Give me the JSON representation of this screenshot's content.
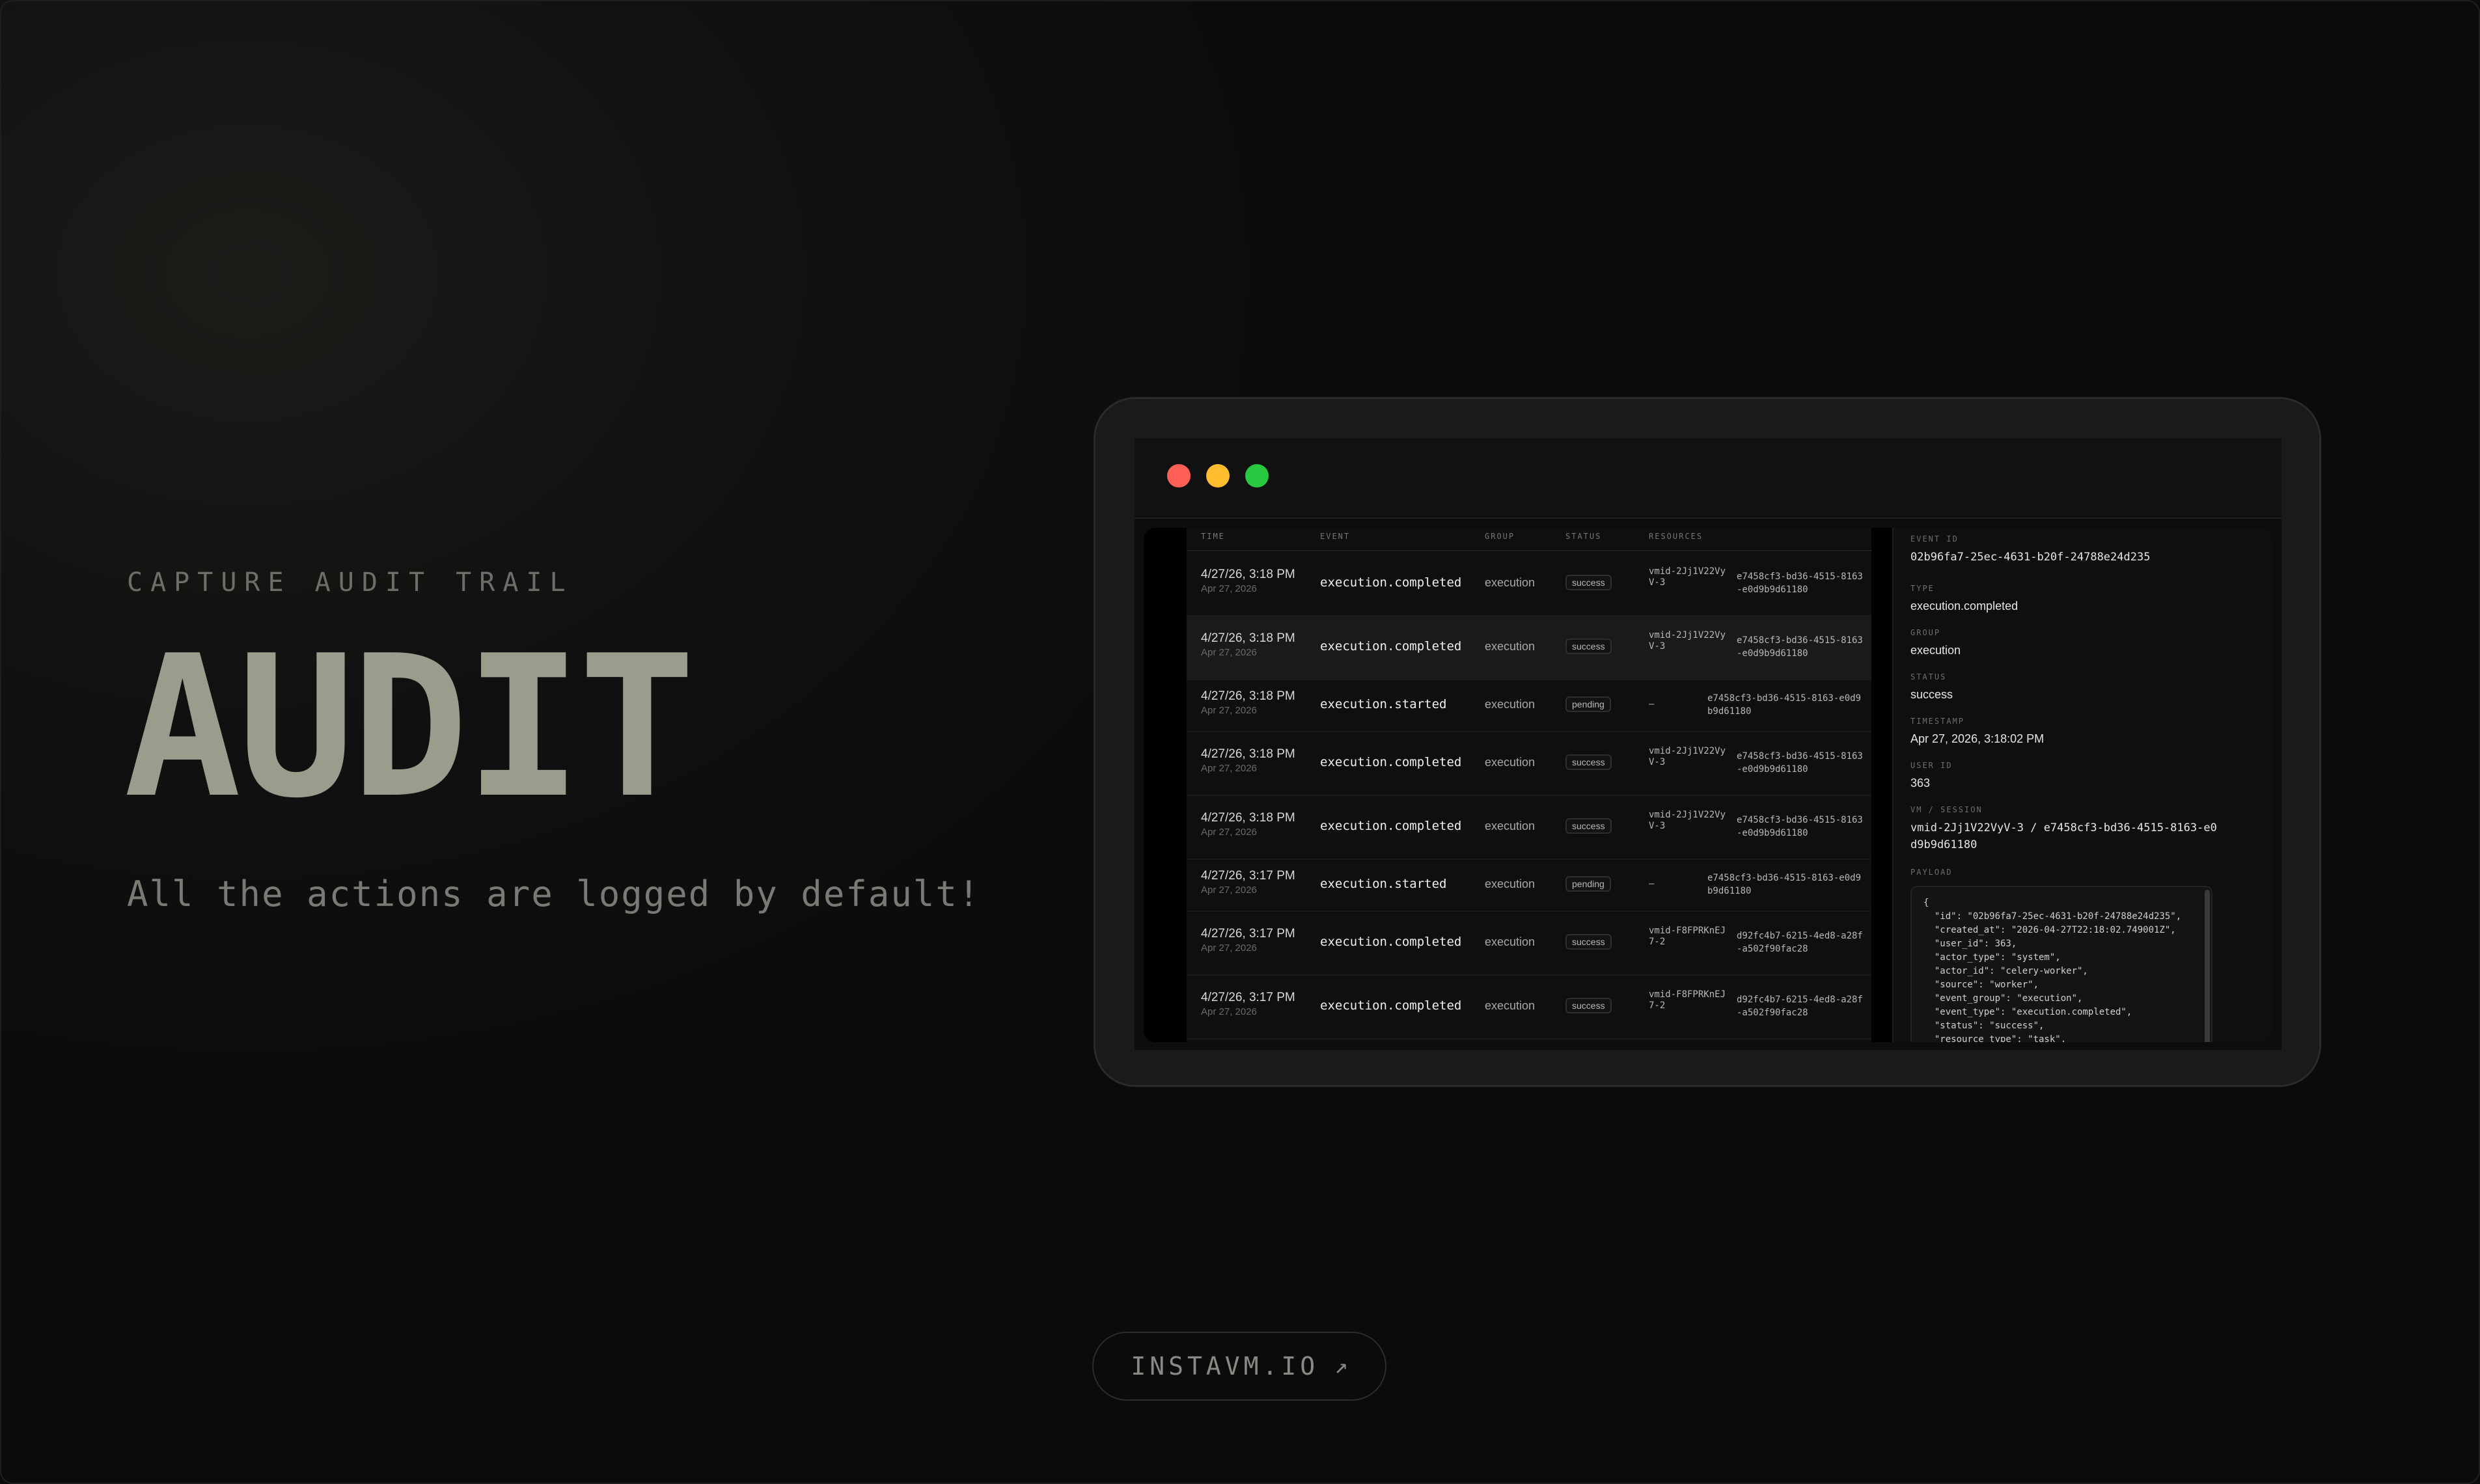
{
  "hero": {
    "eyebrow": "CAPTURE AUDIT TRAIL",
    "title": "AUDIT",
    "tagline": "All the actions are logged by default!"
  },
  "cta": {
    "label": "INSTAVM.IO",
    "arrow": "↗"
  },
  "window": {
    "traffic_lights": [
      "#fe5f57",
      "#febc2e",
      "#28c840"
    ]
  },
  "table": {
    "columns": [
      "TIME",
      "EVENT",
      "GROUP",
      "STATUS",
      "RESOURCES"
    ],
    "rows": [
      {
        "time": "4/27/26, 3:18 PM",
        "date": "Apr 27, 2026",
        "event": "execution.completed",
        "group": "execution",
        "status": "success",
        "vm": "vmid-2Jj1V22VyV-3",
        "session": "e7458cf3-bd36-4515-8163-e0d9b9d61180"
      },
      {
        "time": "4/27/26, 3:18 PM",
        "date": "Apr 27, 2026",
        "event": "execution.completed",
        "group": "execution",
        "status": "success",
        "vm": "vmid-2Jj1V22VyV-3",
        "session": "e7458cf3-bd36-4515-8163-e0d9b9d61180"
      },
      {
        "time": "4/27/26, 3:18 PM",
        "date": "Apr 27, 2026",
        "event": "execution.started",
        "group": "execution",
        "status": "pending",
        "vm": "—",
        "session": "e7458cf3-bd36-4515-8163-e0d9b9d61180"
      },
      {
        "time": "4/27/26, 3:18 PM",
        "date": "Apr 27, 2026",
        "event": "execution.completed",
        "group": "execution",
        "status": "success",
        "vm": "vmid-2Jj1V22VyV-3",
        "session": "e7458cf3-bd36-4515-8163-e0d9b9d61180"
      },
      {
        "time": "4/27/26, 3:18 PM",
        "date": "Apr 27, 2026",
        "event": "execution.completed",
        "group": "execution",
        "status": "success",
        "vm": "vmid-2Jj1V22VyV-3",
        "session": "e7458cf3-bd36-4515-8163-e0d9b9d61180"
      },
      {
        "time": "4/27/26, 3:17 PM",
        "date": "Apr 27, 2026",
        "event": "execution.started",
        "group": "execution",
        "status": "pending",
        "vm": "—",
        "session": "e7458cf3-bd36-4515-8163-e0d9b9d61180"
      },
      {
        "time": "4/27/26, 3:17 PM",
        "date": "Apr 27, 2026",
        "event": "execution.completed",
        "group": "execution",
        "status": "success",
        "vm": "vmid-F8FPRKnEJ7-2",
        "session": "d92fc4b7-6215-4ed8-a28f-a502f90fac28"
      },
      {
        "time": "4/27/26, 3:17 PM",
        "date": "Apr 27, 2026",
        "event": "execution.completed",
        "group": "execution",
        "status": "success",
        "vm": "vmid-F8FPRKnEJ7-2",
        "session": "d92fc4b7-6215-4ed8-a28f-a502f90fac28"
      }
    ]
  },
  "detail": {
    "event_id_label": "EVENT ID",
    "event_id": "02b96fa7-25ec-4631-b20f-24788e24d235",
    "type_label": "TYPE",
    "type": "execution.completed",
    "group_label": "GROUP",
    "group": "execution",
    "status_label": "STATUS",
    "status": "success",
    "timestamp_label": "TIMESTAMP",
    "timestamp": "Apr 27, 2026, 3:18:02 PM",
    "user_id_label": "USER ID",
    "user_id": "363",
    "vm_session_label": "VM / SESSION",
    "vm_session": "vmid-2Jj1V22VyV-3 / e7458cf3-bd36-4515-8163-e0d9b9d61180",
    "payload_label": "PAYLOAD",
    "payload": "{\n  \"id\": \"02b96fa7-25ec-4631-b20f-24788e24d235\",\n  \"created_at\": \"2026-04-27T22:18:02.749001Z\",\n  \"user_id\": 363,\n  \"actor_type\": \"system\",\n  \"actor_id\": \"celery-worker\",\n  \"source\": \"worker\",\n  \"event_group\": \"execution\",\n  \"event_type\": \"execution.completed\",\n  \"status\": \"success\",\n  \"resource_type\": \"task\","
  }
}
